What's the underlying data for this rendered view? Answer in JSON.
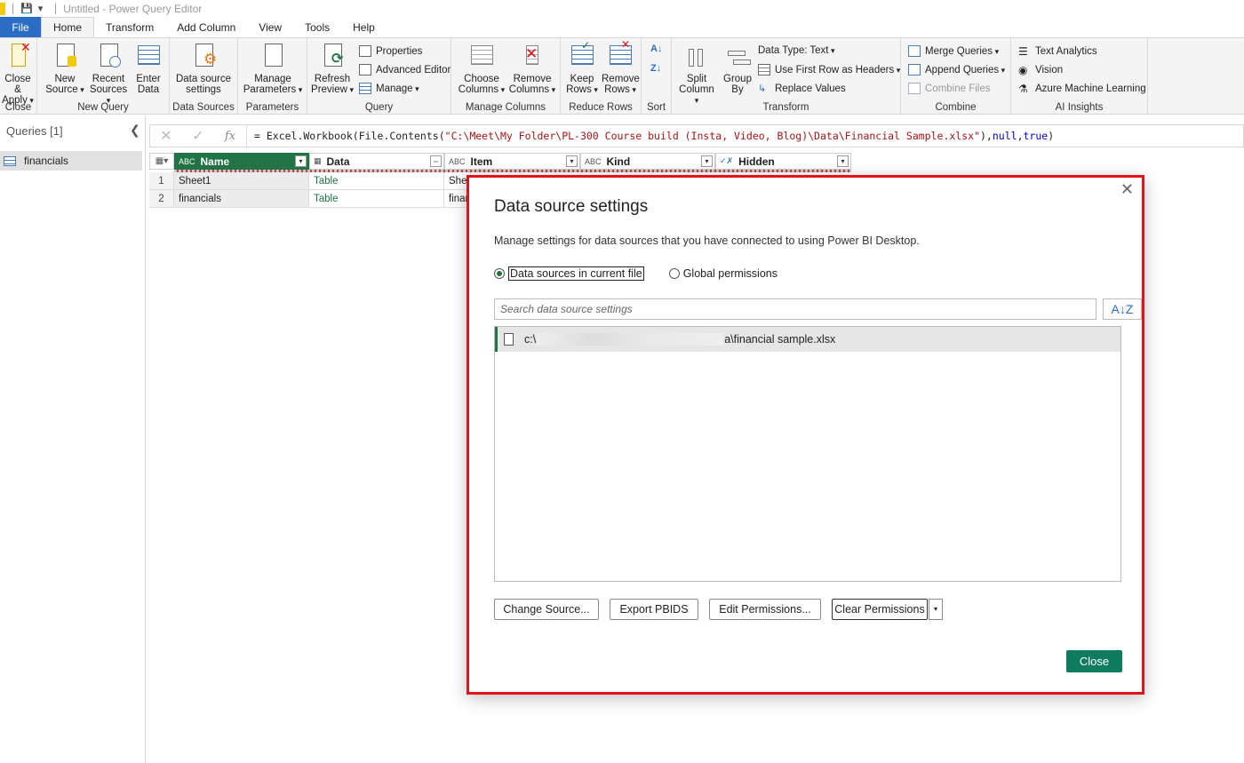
{
  "window": {
    "title": "Untitled - Power Query Editor"
  },
  "tabs": [
    "File",
    "Home",
    "Transform",
    "Add Column",
    "View",
    "Tools",
    "Help"
  ],
  "ribbon": {
    "close_apply": [
      "Close &",
      "Apply"
    ],
    "close_group": "Close",
    "new_source": [
      "New",
      "Source"
    ],
    "recent_sources": [
      "Recent",
      "Sources"
    ],
    "enter_data": [
      "Enter",
      "Data"
    ],
    "new_query_group": "New Query",
    "data_source_settings": [
      "Data source",
      "settings"
    ],
    "data_sources_group": "Data Sources",
    "manage_parameters": [
      "Manage",
      "Parameters"
    ],
    "parameters_group": "Parameters",
    "refresh_preview": [
      "Refresh",
      "Preview"
    ],
    "properties": "Properties",
    "advanced_editor": "Advanced Editor",
    "manage": "Manage",
    "query_group": "Query",
    "choose_columns": [
      "Choose",
      "Columns"
    ],
    "remove_columns": [
      "Remove",
      "Columns"
    ],
    "manage_columns_group": "Manage Columns",
    "keep_rows": [
      "Keep",
      "Rows"
    ],
    "remove_rows": [
      "Remove",
      "Rows"
    ],
    "reduce_rows_group": "Reduce Rows",
    "sort_group": "Sort",
    "split_column": [
      "Split",
      "Column"
    ],
    "group_by": [
      "Group",
      "By"
    ],
    "data_type": "Data Type: Text",
    "use_first_row": "Use First Row as Headers",
    "replace_values": "Replace Values",
    "transform_group": "Transform",
    "merge_queries": "Merge Queries",
    "append_queries": "Append Queries",
    "combine_files": "Combine Files",
    "combine_group": "Combine",
    "text_analytics": "Text Analytics",
    "vision": "Vision",
    "azure_ml": "Azure Machine Learning",
    "ai_insights_group": "AI Insights"
  },
  "queries": {
    "header": "Queries [1]",
    "items": [
      "financials"
    ]
  },
  "formula": {
    "prefix": "= Excel.Workbook(File.Contents(",
    "path": "\"C:\\Meet\\My Folder\\PL-300 Course build (Insta, Video, Blog)\\Data\\Financial Sample.xlsx\"",
    "mid": "), ",
    "null_kw": "null",
    "comma": ", ",
    "true_kw": "true",
    "suffix": ")"
  },
  "grid": {
    "columns": [
      {
        "type": "ABC",
        "name": "Name"
      },
      {
        "type": "",
        "name": "Data"
      },
      {
        "type": "ABC",
        "name": "Item"
      },
      {
        "type": "ABC",
        "name": "Kind"
      },
      {
        "type": "",
        "name": "Hidden"
      }
    ],
    "rows": [
      {
        "num": "1",
        "name": "Sheet1",
        "data": "Table",
        "item": "Shee"
      },
      {
        "num": "2",
        "name": "financials",
        "data": "Table",
        "item": "finar"
      }
    ]
  },
  "dialog": {
    "title": "Data source settings",
    "description": "Manage settings for data sources that you have connected to using Power BI Desktop.",
    "radio_current": "Data sources in current file",
    "radio_global": "Global permissions",
    "search_placeholder": "Search data source settings",
    "sort_icon": "A↓Z",
    "source_prefix": "c:\\",
    "source_suffix": "a\\financial sample.xlsx",
    "buttons": {
      "change_source": "Change Source...",
      "export_pbids": "Export PBIDS",
      "edit_permissions": "Edit Permissions...",
      "clear_permissions": "Clear Permissions",
      "close": "Close"
    }
  },
  "colors": {
    "accent": "#217346",
    "file_tab": "#2b6cc4",
    "highlight_border": "#e3131b",
    "close_button": "#107c5f"
  }
}
